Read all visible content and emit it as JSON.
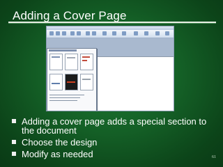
{
  "slide": {
    "title": "Adding a Cover Page",
    "bullets": [
      "Adding a cover page adds a special section to the document",
      "Choose the design",
      "Modify as needed"
    ],
    "page_number": "61"
  },
  "screenshot": {
    "content": "Word window showing Cover Page gallery",
    "gallery_thumbnail_count": 6
  },
  "colors": {
    "background": "#145f26",
    "text": "#ffffff",
    "rule": "#e8eee4"
  },
  "icons": {
    "bullet": "square-bullet-icon"
  }
}
